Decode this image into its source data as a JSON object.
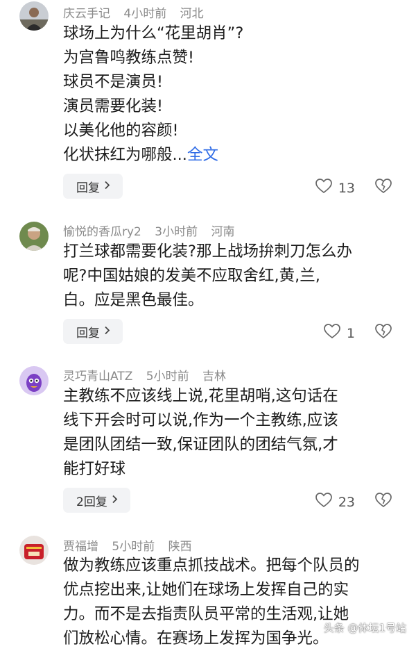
{
  "comments": [
    {
      "author": "庆云手记",
      "time": "4小时前",
      "location": "河北",
      "lines": [
        "球场上为什么“花里胡肖”?",
        "为宫鲁鸣教练点赞!",
        "球员不是演员!",
        "演员需要化装!",
        "以美化他的容颜!",
        "化状抹红为哪般..."
      ],
      "more_link": "全文",
      "reply_label": "回复",
      "likes": "13"
    },
    {
      "author": "愉悦的香瓜ry2",
      "time": "3小时前",
      "location": "河南",
      "lines": [
        "打兰球都需要化装?那上战场拚刺刀怎么办",
        "呢?中国姑娘的发美不应取舍红,黄,兰,",
        "白。应是黑色最佳。"
      ],
      "reply_label": "回复",
      "likes": "1"
    },
    {
      "author": "灵巧青山ATZ",
      "time": "5小时前",
      "location": "吉林",
      "lines": [
        "主教练不应该线上说,花里胡哨,这句话在",
        "线下开会时可以说,作为一个主教练,应该",
        "是团队团结一致,保证团队的团结气氛,才",
        "能打好球"
      ],
      "reply_label": "2回复",
      "likes": "23"
    },
    {
      "author": "贾福增",
      "time": "5小时前",
      "location": "陕西",
      "lines": [
        "做为教练应该重点抓技战术。把每个队员的",
        "优点挖出来,让她们在球场上发挥自己的实",
        "力。而不是去指责队员平常的生活观,让她",
        "们放松心情。在赛场上发挥为国争光。"
      ]
    }
  ],
  "watermark": "头条 @体坛1号站",
  "icons": {
    "like": "heart-outline-icon",
    "dislike": "broken-heart-icon",
    "reply": "chevron-right-icon"
  },
  "colors": {
    "link": "#2e6be6",
    "meta": "#8a8a8a",
    "button_bg": "#f2f3f5"
  }
}
